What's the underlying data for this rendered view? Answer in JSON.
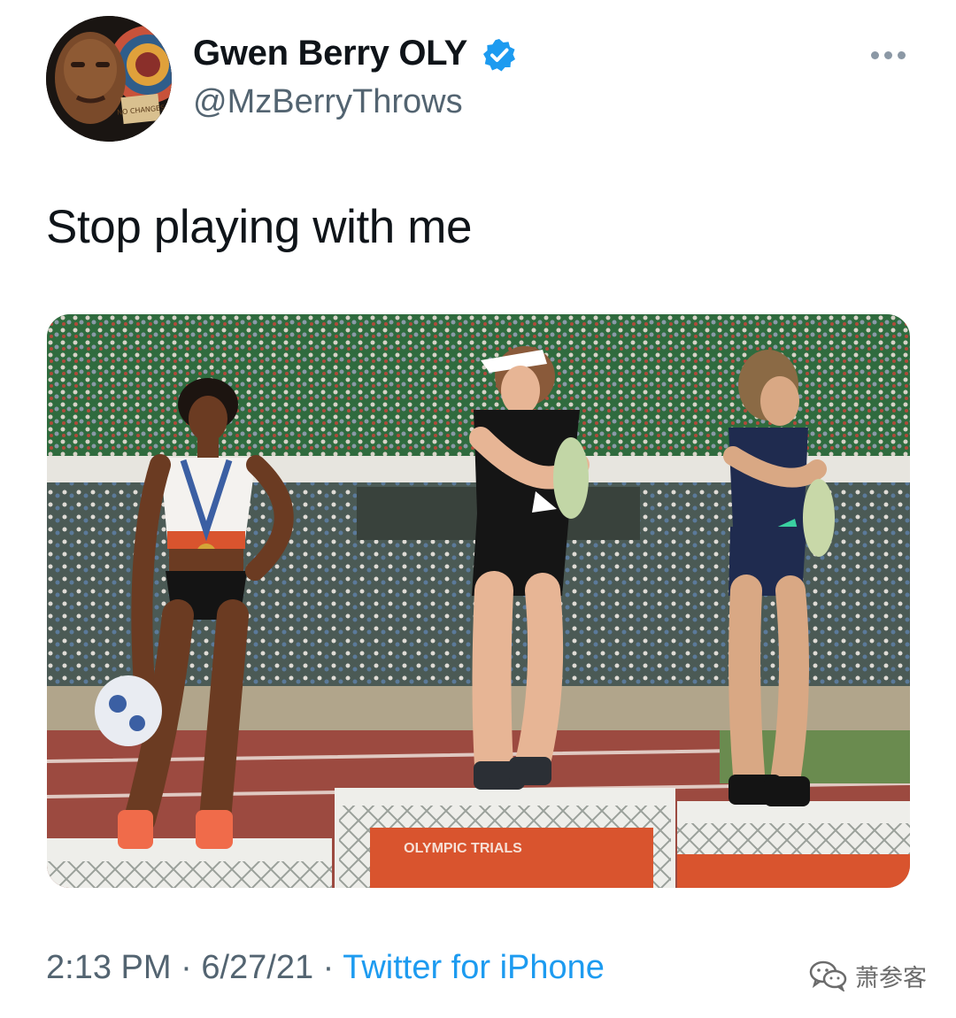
{
  "author": {
    "name": "Gwen Berry OLY",
    "handle": "@MzBerryThrows",
    "verified": true,
    "avatar_sign_text": "NO CHANGES"
  },
  "tweet": {
    "text": "Stop playing with me"
  },
  "photo": {
    "description": "Three athletes standing on a podium at an outdoor track stadium",
    "podium_banner_text": "OLYMPIC TRIALS"
  },
  "footer": {
    "time": "2:13 PM",
    "separator": "·",
    "date": "6/27/21",
    "source": "Twitter for iPhone"
  },
  "watermark": {
    "text": "萧参客"
  },
  "icons": {
    "more": "more-horizontal-icon",
    "verified": "verified-badge-icon",
    "watermark": "wechat-icon"
  },
  "colors": {
    "text_primary": "#0f1419",
    "text_secondary": "#536471",
    "accent": "#1d9bf0"
  }
}
